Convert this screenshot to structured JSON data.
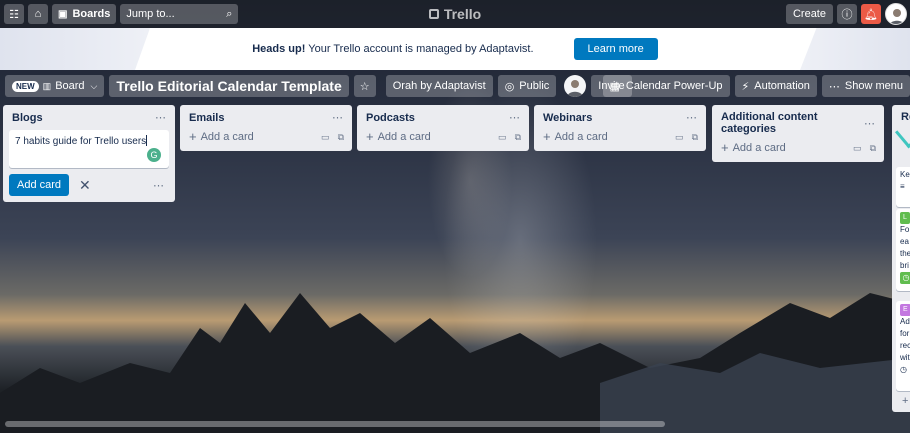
{
  "topbar": {
    "boards_label": "Boards",
    "search_placeholder": "Jump to...",
    "logo_text": "Trello",
    "create_label": "Create"
  },
  "banner": {
    "headline": "Heads up!",
    "message": " Your Trello account is managed by Adaptavist.",
    "button_label": "Learn more"
  },
  "board": {
    "new_badge": "NEW",
    "view_label": "Board",
    "title": "Trello Editorial Calendar Template",
    "workspace_label": "Orah by Adaptavist",
    "visibility_label": "Public",
    "invite_label": "Invite",
    "calendar_label": "Calendar Power-Up",
    "automation_label": "Automation",
    "show_menu_label": "Show menu"
  },
  "lists": [
    {
      "title": "Blogs"
    },
    {
      "title": "Emails"
    },
    {
      "title": "Podcasts"
    },
    {
      "title": "Webinars"
    },
    {
      "title": "Additional content categories"
    }
  ],
  "add_a_card_label": "Add a card",
  "composer": {
    "text": "7 habits guide for Trello users",
    "add_button": "Add card"
  },
  "partial_list": {
    "title": "Re",
    "card1_text": "Ke",
    "card2_label": "L",
    "card2_lines": [
      "Fo",
      "ea",
      "the",
      "bri"
    ],
    "card3_label": "E",
    "card3_lines": [
      "Ad",
      "for",
      "rec",
      "wit"
    ]
  },
  "colors": {
    "primary_button": "#0079bf",
    "notification": "#eb5a46",
    "list_bg": "#ebecf0"
  }
}
